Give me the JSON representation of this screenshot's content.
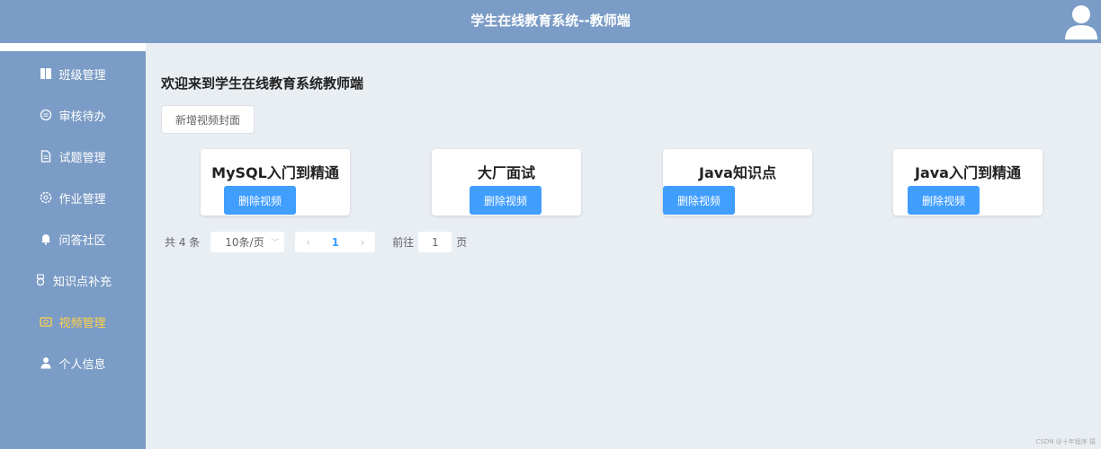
{
  "header": {
    "title": "学生在线教育系统--教师端"
  },
  "sidebar": {
    "items": [
      {
        "label": "班级管理",
        "icon": "book-icon"
      },
      {
        "label": "审核待办",
        "icon": "chat-icon"
      },
      {
        "label": "试题管理",
        "icon": "document-icon"
      },
      {
        "label": "作业管理",
        "icon": "gear-icon"
      },
      {
        "label": "问答社区",
        "icon": "bell-icon"
      },
      {
        "label": "知识点补充",
        "icon": "medal-icon"
      },
      {
        "label": "视频管理",
        "icon": "camera-icon",
        "active": true
      },
      {
        "label": "个人信息",
        "icon": "user-icon"
      }
    ],
    "active_color": "#ffd04b"
  },
  "main": {
    "welcome": "欢迎来到学生在线教育系统教师端",
    "add_button": "新增视频封面",
    "cards": [
      {
        "title": "MySQL入门到精通",
        "delete": "删除视频"
      },
      {
        "title": "大厂面试",
        "delete": "删除视频"
      },
      {
        "title": "Java知识点",
        "delete": "删除视频"
      },
      {
        "title": "Java入门到精通",
        "delete": "删除视频"
      }
    ]
  },
  "pagination": {
    "total": "共 4 条",
    "page_size": "10条/页",
    "current": "1",
    "goto_label": "前往",
    "goto_value": "1",
    "page_suffix": "页"
  },
  "watermark": "CSDN @十年程序 猿"
}
